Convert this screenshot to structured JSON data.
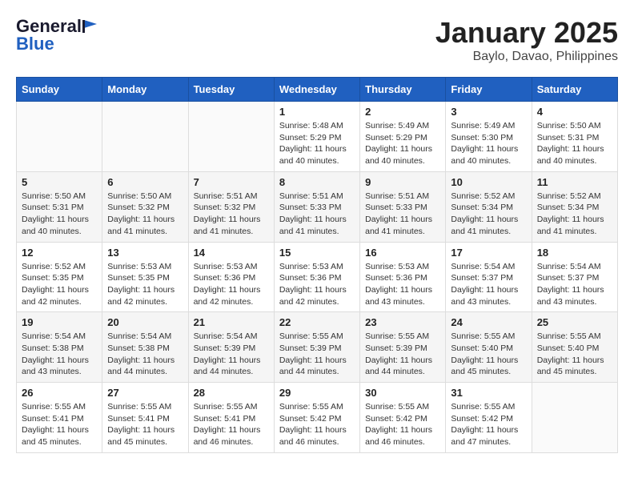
{
  "header": {
    "logo_general": "General",
    "logo_blue": "Blue",
    "month": "January 2025",
    "location": "Baylo, Davao, Philippines"
  },
  "weekdays": [
    "Sunday",
    "Monday",
    "Tuesday",
    "Wednesday",
    "Thursday",
    "Friday",
    "Saturday"
  ],
  "weeks": [
    [
      {
        "day": "",
        "sunrise": "",
        "sunset": "",
        "daylight": ""
      },
      {
        "day": "",
        "sunrise": "",
        "sunset": "",
        "daylight": ""
      },
      {
        "day": "",
        "sunrise": "",
        "sunset": "",
        "daylight": ""
      },
      {
        "day": "1",
        "sunrise": "Sunrise: 5:48 AM",
        "sunset": "Sunset: 5:29 PM",
        "daylight": "Daylight: 11 hours and 40 minutes."
      },
      {
        "day": "2",
        "sunrise": "Sunrise: 5:49 AM",
        "sunset": "Sunset: 5:29 PM",
        "daylight": "Daylight: 11 hours and 40 minutes."
      },
      {
        "day": "3",
        "sunrise": "Sunrise: 5:49 AM",
        "sunset": "Sunset: 5:30 PM",
        "daylight": "Daylight: 11 hours and 40 minutes."
      },
      {
        "day": "4",
        "sunrise": "Sunrise: 5:50 AM",
        "sunset": "Sunset: 5:31 PM",
        "daylight": "Daylight: 11 hours and 40 minutes."
      }
    ],
    [
      {
        "day": "5",
        "sunrise": "Sunrise: 5:50 AM",
        "sunset": "Sunset: 5:31 PM",
        "daylight": "Daylight: 11 hours and 40 minutes."
      },
      {
        "day": "6",
        "sunrise": "Sunrise: 5:50 AM",
        "sunset": "Sunset: 5:32 PM",
        "daylight": "Daylight: 11 hours and 41 minutes."
      },
      {
        "day": "7",
        "sunrise": "Sunrise: 5:51 AM",
        "sunset": "Sunset: 5:32 PM",
        "daylight": "Daylight: 11 hours and 41 minutes."
      },
      {
        "day": "8",
        "sunrise": "Sunrise: 5:51 AM",
        "sunset": "Sunset: 5:33 PM",
        "daylight": "Daylight: 11 hours and 41 minutes."
      },
      {
        "day": "9",
        "sunrise": "Sunrise: 5:51 AM",
        "sunset": "Sunset: 5:33 PM",
        "daylight": "Daylight: 11 hours and 41 minutes."
      },
      {
        "day": "10",
        "sunrise": "Sunrise: 5:52 AM",
        "sunset": "Sunset: 5:34 PM",
        "daylight": "Daylight: 11 hours and 41 minutes."
      },
      {
        "day": "11",
        "sunrise": "Sunrise: 5:52 AM",
        "sunset": "Sunset: 5:34 PM",
        "daylight": "Daylight: 11 hours and 41 minutes."
      }
    ],
    [
      {
        "day": "12",
        "sunrise": "Sunrise: 5:52 AM",
        "sunset": "Sunset: 5:35 PM",
        "daylight": "Daylight: 11 hours and 42 minutes."
      },
      {
        "day": "13",
        "sunrise": "Sunrise: 5:53 AM",
        "sunset": "Sunset: 5:35 PM",
        "daylight": "Daylight: 11 hours and 42 minutes."
      },
      {
        "day": "14",
        "sunrise": "Sunrise: 5:53 AM",
        "sunset": "Sunset: 5:36 PM",
        "daylight": "Daylight: 11 hours and 42 minutes."
      },
      {
        "day": "15",
        "sunrise": "Sunrise: 5:53 AM",
        "sunset": "Sunset: 5:36 PM",
        "daylight": "Daylight: 11 hours and 42 minutes."
      },
      {
        "day": "16",
        "sunrise": "Sunrise: 5:53 AM",
        "sunset": "Sunset: 5:36 PM",
        "daylight": "Daylight: 11 hours and 43 minutes."
      },
      {
        "day": "17",
        "sunrise": "Sunrise: 5:54 AM",
        "sunset": "Sunset: 5:37 PM",
        "daylight": "Daylight: 11 hours and 43 minutes."
      },
      {
        "day": "18",
        "sunrise": "Sunrise: 5:54 AM",
        "sunset": "Sunset: 5:37 PM",
        "daylight": "Daylight: 11 hours and 43 minutes."
      }
    ],
    [
      {
        "day": "19",
        "sunrise": "Sunrise: 5:54 AM",
        "sunset": "Sunset: 5:38 PM",
        "daylight": "Daylight: 11 hours and 43 minutes."
      },
      {
        "day": "20",
        "sunrise": "Sunrise: 5:54 AM",
        "sunset": "Sunset: 5:38 PM",
        "daylight": "Daylight: 11 hours and 44 minutes."
      },
      {
        "day": "21",
        "sunrise": "Sunrise: 5:54 AM",
        "sunset": "Sunset: 5:39 PM",
        "daylight": "Daylight: 11 hours and 44 minutes."
      },
      {
        "day": "22",
        "sunrise": "Sunrise: 5:55 AM",
        "sunset": "Sunset: 5:39 PM",
        "daylight": "Daylight: 11 hours and 44 minutes."
      },
      {
        "day": "23",
        "sunrise": "Sunrise: 5:55 AM",
        "sunset": "Sunset: 5:39 PM",
        "daylight": "Daylight: 11 hours and 44 minutes."
      },
      {
        "day": "24",
        "sunrise": "Sunrise: 5:55 AM",
        "sunset": "Sunset: 5:40 PM",
        "daylight": "Daylight: 11 hours and 45 minutes."
      },
      {
        "day": "25",
        "sunrise": "Sunrise: 5:55 AM",
        "sunset": "Sunset: 5:40 PM",
        "daylight": "Daylight: 11 hours and 45 minutes."
      }
    ],
    [
      {
        "day": "26",
        "sunrise": "Sunrise: 5:55 AM",
        "sunset": "Sunset: 5:41 PM",
        "daylight": "Daylight: 11 hours and 45 minutes."
      },
      {
        "day": "27",
        "sunrise": "Sunrise: 5:55 AM",
        "sunset": "Sunset: 5:41 PM",
        "daylight": "Daylight: 11 hours and 45 minutes."
      },
      {
        "day": "28",
        "sunrise": "Sunrise: 5:55 AM",
        "sunset": "Sunset: 5:41 PM",
        "daylight": "Daylight: 11 hours and 46 minutes."
      },
      {
        "day": "29",
        "sunrise": "Sunrise: 5:55 AM",
        "sunset": "Sunset: 5:42 PM",
        "daylight": "Daylight: 11 hours and 46 minutes."
      },
      {
        "day": "30",
        "sunrise": "Sunrise: 5:55 AM",
        "sunset": "Sunset: 5:42 PM",
        "daylight": "Daylight: 11 hours and 46 minutes."
      },
      {
        "day": "31",
        "sunrise": "Sunrise: 5:55 AM",
        "sunset": "Sunset: 5:42 PM",
        "daylight": "Daylight: 11 hours and 47 minutes."
      },
      {
        "day": "",
        "sunrise": "",
        "sunset": "",
        "daylight": ""
      }
    ]
  ]
}
